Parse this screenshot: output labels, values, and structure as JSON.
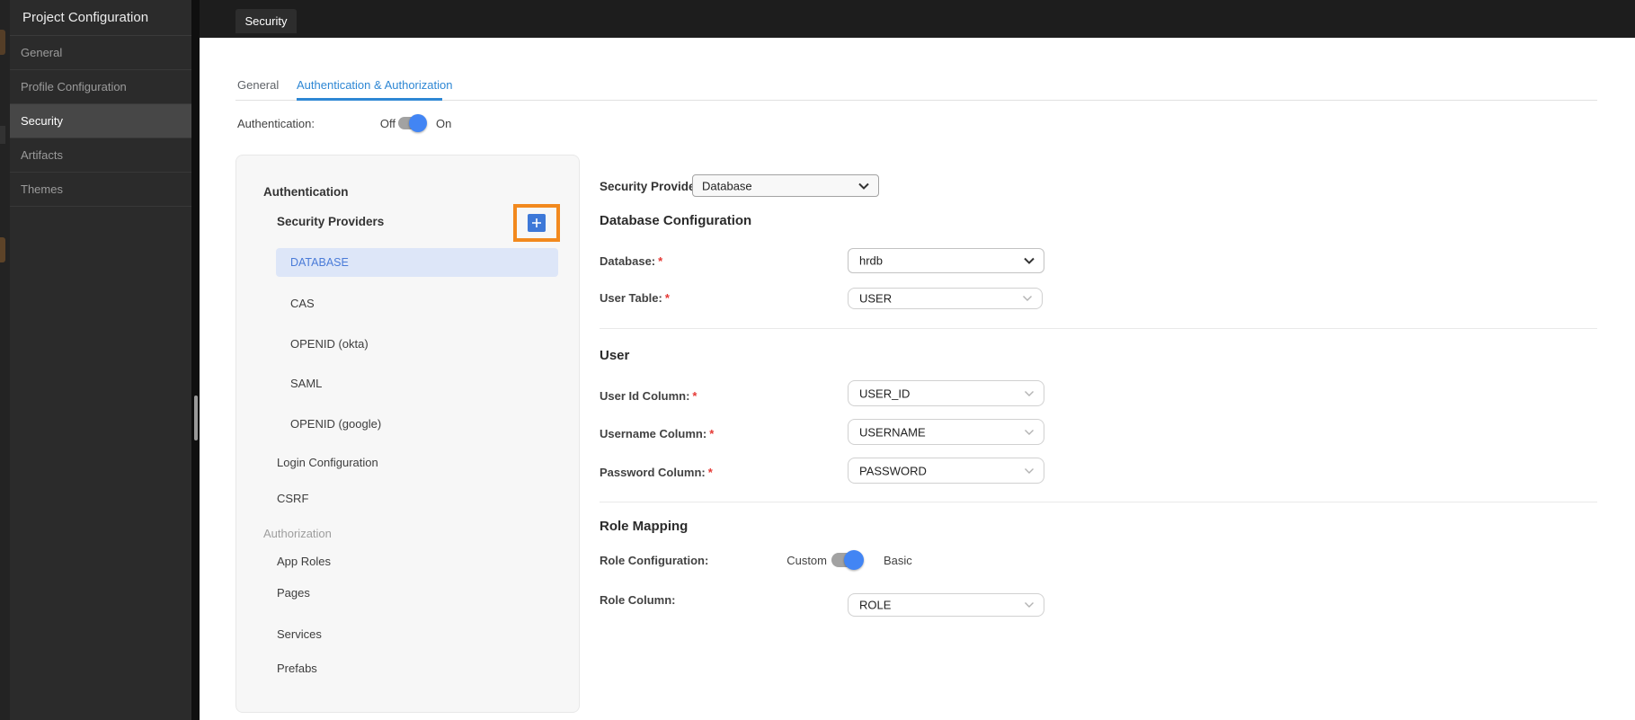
{
  "sidebar": {
    "title": "Project Configuration",
    "items": [
      {
        "label": "General",
        "active": false
      },
      {
        "label": "Profile Configuration",
        "active": false
      },
      {
        "label": "Security",
        "active": true
      },
      {
        "label": "Artifacts",
        "active": false
      },
      {
        "label": "Themes",
        "active": false
      }
    ]
  },
  "topbar": {
    "tab_label": "Security"
  },
  "page": {
    "tabs": [
      {
        "label": "General",
        "active": false
      },
      {
        "label": "Authentication & Authorization",
        "active": true
      }
    ],
    "auth_toggle": {
      "label": "Authentication:",
      "off": "Off",
      "on": "On",
      "state": "on"
    }
  },
  "nav": {
    "section_auth": "Authentication",
    "providers_header": "Security Providers",
    "providers": [
      {
        "label": "DATABASE",
        "selected": true
      },
      {
        "label": "CAS",
        "selected": false
      },
      {
        "label": "OPENID (okta)",
        "selected": false
      },
      {
        "label": "SAML",
        "selected": false
      },
      {
        "label": "OPENID (google)",
        "selected": false
      }
    ],
    "login_config": "Login Configuration",
    "csrf": "CSRF",
    "section_authz": "Authorization",
    "authz_items": [
      {
        "label": "App Roles"
      },
      {
        "label": "Pages"
      },
      {
        "label": "Services"
      },
      {
        "label": "Prefabs"
      }
    ]
  },
  "form": {
    "provider": {
      "label": "Security Provider",
      "value": "Database"
    },
    "db": {
      "title": "Database Configuration",
      "rows": [
        {
          "label": "Database:",
          "req": "*",
          "value": "hrdb"
        },
        {
          "label": "User Table:",
          "req": "*",
          "value": "USER"
        }
      ]
    },
    "user": {
      "title": "User",
      "rows": [
        {
          "label": "User Id Column:",
          "req": "*",
          "value": "USER_ID"
        },
        {
          "label": "Username Column:",
          "req": "*",
          "value": "USERNAME"
        },
        {
          "label": "Password Column:",
          "req": "*",
          "value": "PASSWORD"
        }
      ]
    },
    "role": {
      "title": "Role Mapping",
      "toggle": {
        "label": "Role Configuration:",
        "left": "Custom",
        "right": "Basic",
        "state": "right"
      },
      "rows": [
        {
          "label": "Role Column:",
          "value": "ROLE"
        }
      ]
    }
  },
  "icons": {
    "plus": "plus-icon",
    "chevron_down": "chevron-down-icon"
  },
  "colors": {
    "accent_blue": "#2e87d4",
    "toggle_knob_blue": "#4285f4",
    "selected_nav_bg": "#dde6f8",
    "selected_nav_text": "#4a7bd8",
    "annotation_orange": "#f2891e",
    "required_red": "#e53935"
  }
}
